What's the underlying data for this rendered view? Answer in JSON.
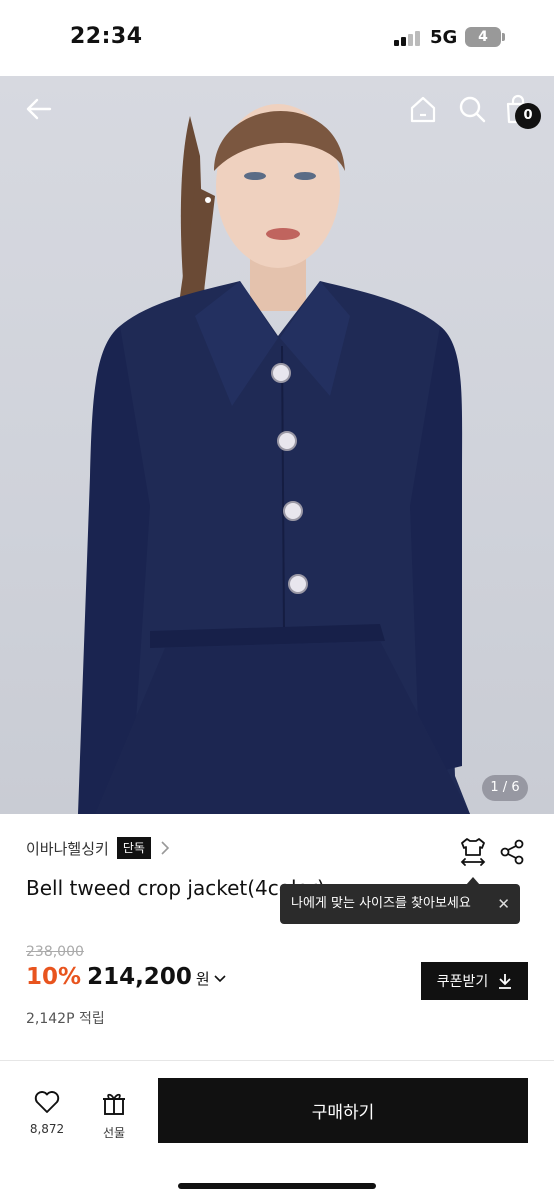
{
  "status_bar": {
    "time": "22:34",
    "network": "5G",
    "battery": "4"
  },
  "hero": {
    "cart_count": "0",
    "page_counter": "1 / 6",
    "icons": [
      "back-arrow-icon",
      "home-icon",
      "search-icon",
      "shopping-bag-icon"
    ],
    "colors": {
      "jacket": "#1f2a55",
      "background": "#d4d6de"
    }
  },
  "product": {
    "brand": "이바나헬싱키",
    "exclusive_badge": "단독",
    "title": "Bell tweed crop jacket(4color)",
    "original_price": "238,000",
    "discount": "10%",
    "price": "214,200",
    "currency": "원",
    "points": "2,142P 적립",
    "coupon_label": "쿠폰받기",
    "icons": [
      "size-guide-icon",
      "share-icon",
      "download-icon"
    ]
  },
  "tooltip": {
    "text": "나에게 맞는 사이즈를 찾아보세요",
    "close": "✕"
  },
  "bottom_bar": {
    "like_count": "8,872",
    "gift_label": "선물",
    "buy_label": "구매하기",
    "accent": "#e8541e"
  }
}
